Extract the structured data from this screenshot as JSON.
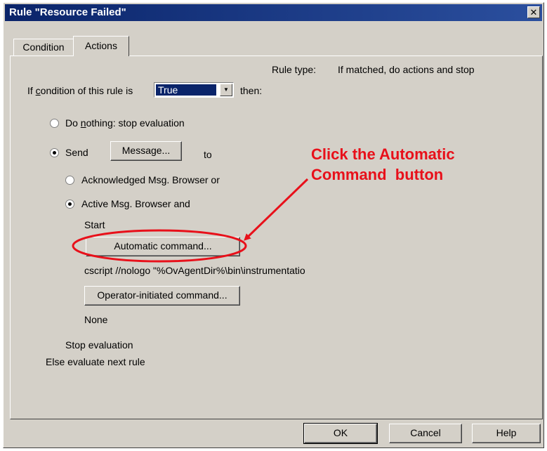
{
  "window": {
    "title": "Rule \"Resource Failed\"",
    "close_glyph": "✕"
  },
  "tabs": [
    {
      "label": "Condition",
      "active": false
    },
    {
      "label": "Actions",
      "active": true
    }
  ],
  "rule_type": {
    "label": "Rule type:",
    "value": "If matched, do actions and stop"
  },
  "condition_row": {
    "prefix_before": "If ",
    "prefix_underlined": "c",
    "prefix_after": "ondition of this rule is",
    "selected": "True",
    "suffix": "then:"
  },
  "options": {
    "do_nothing_before": "Do ",
    "do_nothing_underlined": "n",
    "do_nothing_after": "othing: stop evaluation",
    "do_nothing_checked": false,
    "send_label": "Send",
    "send_checked": true,
    "message_button": "Message...",
    "to_label": "to",
    "ack_browser": "Acknowledged Msg. Browser or",
    "ack_checked": false,
    "active_browser": "Active Msg. Browser and",
    "active_checked": true,
    "start_label": "Start",
    "automatic_button": "Automatic command...",
    "automatic_value": "cscript //nologo \"%OvAgentDir%\\bin\\instrumentatio",
    "operator_button": "Operator-initiated command...",
    "operator_value": "None",
    "stop_label": "Stop evaluation",
    "else_label": "Else evaluate next rule"
  },
  "footer": {
    "ok": "OK",
    "cancel": "Cancel",
    "help": "Help"
  },
  "annotation": {
    "text": "Click the Automatic\nCommand  button",
    "color": "#e8101a"
  },
  "colors": {
    "dialog_bg": "#d4d0c8",
    "title_bar": "#0a246a",
    "selection": "#0a246a"
  }
}
